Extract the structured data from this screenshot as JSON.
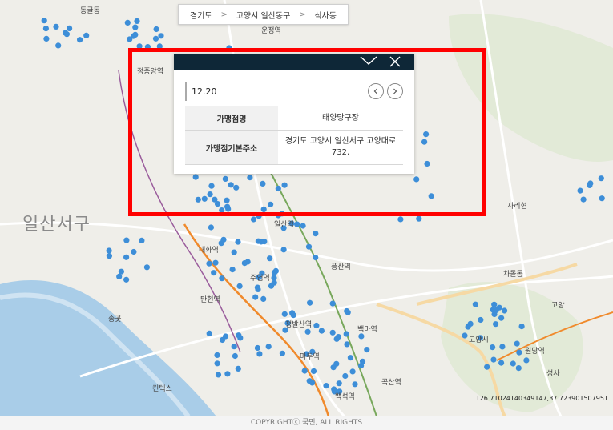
{
  "breadcrumb": {
    "level1": "경기도",
    "level2": "고양시 일산동구",
    "level3": "식사동",
    "separator": ">"
  },
  "popup": {
    "minimize_icon": "chevron-down-icon",
    "close_icon": "close-icon",
    "date": "12.20",
    "prev_icon": "chevron-left-icon",
    "next_icon": "chevron-right-icon",
    "rows": [
      {
        "label": "가맹점명",
        "value": "태양당구장"
      },
      {
        "label": "가맹점기본주소",
        "value": "경기도 고양시 일산서구 고양대로 732,"
      }
    ]
  },
  "map": {
    "district_label": "일산서구",
    "place_labels": [
      "동굴동",
      "운정역",
      "정중앙역",
      "일산역",
      "탄현역",
      "대화역",
      "주엽역",
      "정발산역",
      "마두역",
      "백석역",
      "풍산역",
      "백마역",
      "곡산역",
      "사리현",
      "고양",
      "고양시",
      "원당역",
      "성사",
      "킨텍스",
      "송곳",
      "차돌동"
    ],
    "coordinate_readout": "126.71024140349147,37.723901507951",
    "marker_color": "#3d8ed8",
    "highlight_color": "#ff0000"
  },
  "footer": {
    "copyright": "COPYRIGHTⓒ 국민, ALL RIGHTS"
  }
}
